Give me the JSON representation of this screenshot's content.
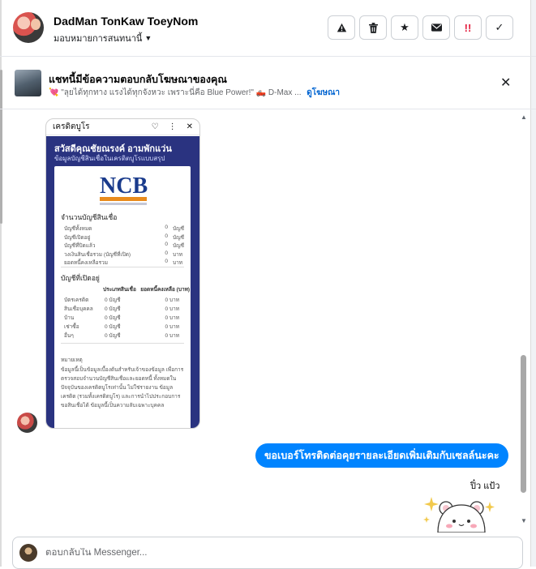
{
  "header": {
    "contact_name": "DadMan TonKaw ToeyNom",
    "assign_label": "มอบหมายการสนทนานี้",
    "actions": [
      {
        "name": "report-spam",
        "icon": "⚠"
      },
      {
        "name": "delete",
        "icon": "🗑"
      },
      {
        "name": "star",
        "icon": "★"
      },
      {
        "name": "mark-unread",
        "icon": "✉"
      },
      {
        "name": "follow-up",
        "icon": "!!"
      },
      {
        "name": "mark-done",
        "icon": "✓"
      }
    ]
  },
  "ad": {
    "title": "แชทนี้มีข้อความตอบกลับโฆษณาของคุณ",
    "snippet": "\"ลุยได้ทุกทาง แรงได้ทุกจังหวะ เพราะนี่คือ Blue Power!\" 🛻 D-Max ...",
    "view_ad_label": "ดูโฆษณา",
    "close_icon": "close-icon"
  },
  "phone_card": {
    "topbar_title": "เครดิตบูโร",
    "greeting": "สวัสดีคุณชัยณรงค์ อามพักแว่น",
    "greeting_sub": "ข้อมูลบัญชีสินเชื่อในเครดิตบูโรแบบสรุป",
    "logo": "NCB",
    "logo_sub": "National Credit Bureau",
    "account_summary_title": "จำนวนบัญชีสินเชื่อ",
    "summary_rows": [
      {
        "label": "บัญชีทั้งหมด",
        "value": "0",
        "unit": "บัญชี"
      },
      {
        "label": "บัญชีเปิดอยู่",
        "value": "0",
        "unit": "บัญชี"
      },
      {
        "label": "บัญชีที่ปิดแล้ว",
        "value": "0",
        "unit": "บัญชี"
      },
      {
        "label": "วงเงินสินเชื่อรวม (บัญชีที่เปิด)",
        "value": "0",
        "unit": "บาท"
      },
      {
        "label": "ยอดหนี้คงเหลือรวม",
        "value": "0",
        "unit": "บาท"
      }
    ],
    "open_accounts_title": "บัญชีที่เปิดอยู่",
    "table_headers": [
      "ประเภทสินเชื่อ",
      "ยอดหนี้คงเหลือ (บาท)"
    ],
    "table_rows": [
      {
        "type": "บัตรเครดิต",
        "count": "0 บัญชี",
        "amount": "0 บาท"
      },
      {
        "type": "สินเชื่อบุคคล",
        "count": "0 บัญชี",
        "amount": "0 บาท"
      },
      {
        "type": "บ้าน",
        "count": "0 บัญชี",
        "amount": "0 บาท"
      },
      {
        "type": "เช่าซื้อ",
        "count": "0 บัญชี",
        "amount": "0 บาท"
      },
      {
        "type": "อื่นๆ",
        "count": "0 บัญชี",
        "amount": "0 บาท"
      }
    ],
    "note_title": "หมายเหตุ",
    "note_text": "ข้อมูลนี้เป็นข้อมูลเบื้องต้นสำหรับเจ้าของข้อมูล เพื่อการตรวจสอบจำนวนบัญชีสินเชื่อและยอดหนี้ ทั้งหมดในปัจจุบันของเครดิตบูโรเท่านั้น ไม่ใช่รายงาน ข้อมูลเครดิต (รวมทั้งเครดิตบูโร) และการนำไปประกอบการขอสินเชื่อได้ ข้อมูลนี้เป็นความลับเฉพาะบุคคล"
  },
  "messages": {
    "outgoing_text": "ขอเบอร์โทรติดต่อคุยรายละเอียดเพิ่มเติมกับเซลล์นะคะ",
    "sender_label": "ปิ๋ว แป้ว",
    "sticker": "bear-sticker"
  },
  "composer": {
    "placeholder": "ตอบกลับใน Messenger..."
  },
  "colors": {
    "accent": "#0084ff",
    "ncb_blue": "#2a3380",
    "ncb_orange": "#e98b1c",
    "follow_up_red": "#e41e3f"
  }
}
